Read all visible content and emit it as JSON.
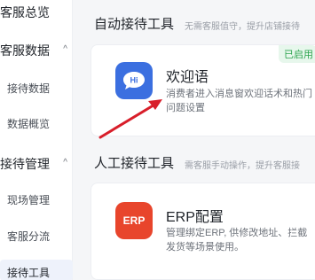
{
  "sidebar": {
    "items": [
      {
        "label": "客服总览",
        "kind": "group"
      },
      {
        "label": "客服数据",
        "kind": "group",
        "arrow": "chevron-up"
      },
      {
        "label": "接待数据",
        "kind": "sub"
      },
      {
        "label": "数据概览",
        "kind": "sub"
      },
      {
        "label": "接待管理",
        "kind": "group",
        "arrow": "chevron-up"
      },
      {
        "label": "现场管理",
        "kind": "sub"
      },
      {
        "label": "客服分流",
        "kind": "sub"
      },
      {
        "label": "接待工具",
        "kind": "sub",
        "active": true
      }
    ],
    "arrow_glyph": "^"
  },
  "auto_section": {
    "title": "自动接待工具",
    "desc": "无需客服值守，提升店铺接待"
  },
  "welcome_card": {
    "title": "欢迎语",
    "desc": "消费者进入消息窗欢迎话术和热门问题设置",
    "badge": "已启用",
    "icon_text": "Hi",
    "icon_color": "#3b6fe0"
  },
  "manual_section": {
    "title": "人工接待工具",
    "desc": "需客服手动操作，提升客服接"
  },
  "erp_card": {
    "title": "ERP配置",
    "desc": "管理绑定ERP, 供修改地址、拦截发货等场景使用。",
    "icon_text": "ERP",
    "icon_color": "#e8452c"
  },
  "colors": {
    "annotation_arrow": "#d81e2a",
    "badge_green": "#2ea44f"
  }
}
